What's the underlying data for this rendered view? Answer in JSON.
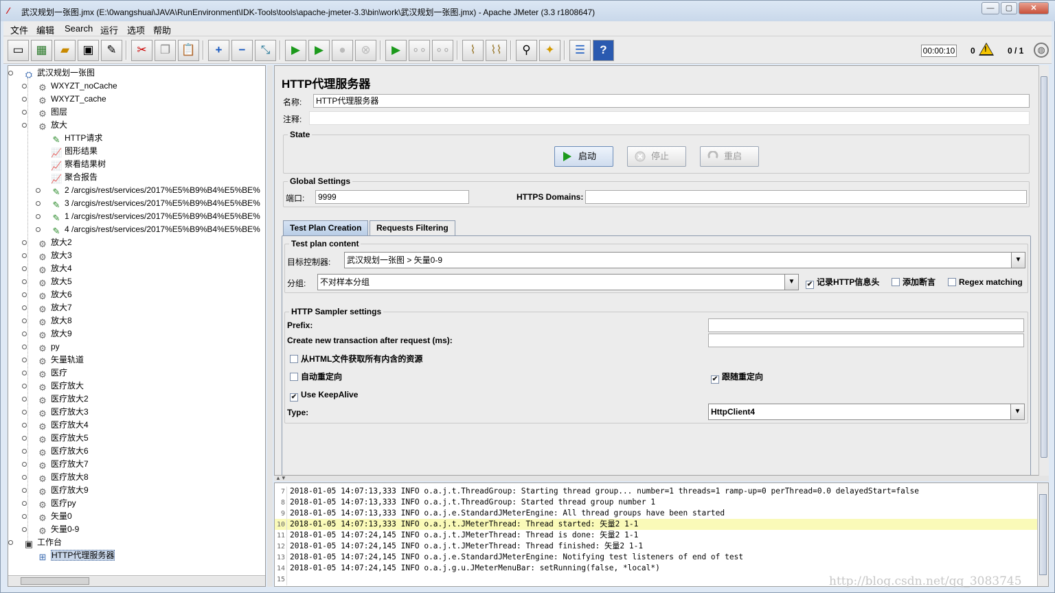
{
  "window": {
    "title": "武汉规划一张图.jmx (E:\\0wangshuai\\JAVA\\RunEnvironment\\IDK-Tools\\tools\\apache-jmeter-3.3\\bin\\work\\武汉规划一张图.jmx) - Apache JMeter (3.3 r1808647)",
    "min": "—",
    "max": "▢",
    "close": "✕"
  },
  "menu": [
    "文件",
    "编辑",
    "Search",
    "运行",
    "选项",
    "帮助"
  ],
  "toolbar": {
    "timer": "00:00:10",
    "errors": "0",
    "threads": "0 / 1",
    "icons": [
      "new-icon",
      "templates-icon",
      "open-icon",
      "save-icon",
      "save-as-icon",
      "cut-icon",
      "copy-icon",
      "paste-icon",
      "expand-icon",
      "collapse-icon",
      "toggle-icon",
      "start-icon",
      "start-no-pause-icon",
      "stop-icon",
      "shutdown-icon",
      "remote-start-icon",
      "remote-stop-icon",
      "remote-exit-icon",
      "clear-icon",
      "clear-all-icon",
      "search-icon",
      "reset-search-icon",
      "function-helper-icon",
      "help-icon"
    ]
  },
  "tree": {
    "items": [
      {
        "label": "武汉规划一张图",
        "icon": "test-plan-icon"
      },
      {
        "label": "WXYZT_noCache",
        "icon": "gear-icon"
      },
      {
        "label": "WXYZT_cache",
        "icon": "gear-icon"
      },
      {
        "label": "图层",
        "icon": "gear-icon"
      },
      {
        "label": "放大",
        "icon": "gear-icon"
      },
      {
        "label": "HTTP请求",
        "icon": "pipette-icon"
      },
      {
        "label": "图形结果",
        "icon": "graph-icon"
      },
      {
        "label": "察看结果树",
        "icon": "graph-icon"
      },
      {
        "label": "聚合报告",
        "icon": "graph-icon"
      },
      {
        "label": "2 /arcgis/rest/services/2017%E5%B9%B4%E5%BE%",
        "icon": "pipette-icon"
      },
      {
        "label": "3 /arcgis/rest/services/2017%E5%B9%B4%E5%BE%",
        "icon": "pipette-icon"
      },
      {
        "label": "1 /arcgis/rest/services/2017%E5%B9%B4%E5%BE%",
        "icon": "pipette-icon"
      },
      {
        "label": "4 /arcgis/rest/services/2017%E5%B9%B4%E5%BE%",
        "icon": "pipette-icon"
      },
      {
        "label": "放大2",
        "icon": "gear-icon"
      },
      {
        "label": "放大3",
        "icon": "gear-icon"
      },
      {
        "label": "放大4",
        "icon": "gear-icon"
      },
      {
        "label": "放大5",
        "icon": "gear-icon"
      },
      {
        "label": "放大6",
        "icon": "gear-icon"
      },
      {
        "label": "放大7",
        "icon": "gear-icon"
      },
      {
        "label": "放大8",
        "icon": "gear-icon"
      },
      {
        "label": "放大9",
        "icon": "gear-icon"
      },
      {
        "label": "py",
        "icon": "gear-icon"
      },
      {
        "label": "矢量轨道",
        "icon": "gear-icon"
      },
      {
        "label": "医疗",
        "icon": "gear-icon"
      },
      {
        "label": "医疗放大",
        "icon": "gear-icon"
      },
      {
        "label": "医疗放大2",
        "icon": "gear-icon"
      },
      {
        "label": "医疗放大3",
        "icon": "gear-icon"
      },
      {
        "label": "医疗放大4",
        "icon": "gear-icon"
      },
      {
        "label": "医疗放大5",
        "icon": "gear-icon"
      },
      {
        "label": "医疗放大6",
        "icon": "gear-icon"
      },
      {
        "label": "医疗放大7",
        "icon": "gear-icon"
      },
      {
        "label": "医疗放大8",
        "icon": "gear-icon"
      },
      {
        "label": "医疗放大9",
        "icon": "gear-icon"
      },
      {
        "label": "医疗py",
        "icon": "gear-icon"
      },
      {
        "label": "矢量0",
        "icon": "gear-icon"
      },
      {
        "label": "矢量0-9",
        "icon": "gear-icon"
      },
      {
        "label": "工作台",
        "icon": "workbench-icon"
      },
      {
        "label": "HTTP代理服务器",
        "icon": "proxy-icon"
      }
    ]
  },
  "panel": {
    "title": "HTTP代理服务器",
    "name_label": "名称:",
    "name_value": "HTTP代理服务器",
    "comment_label": "注释:",
    "comment_value": "",
    "state_group": "State",
    "start": "启动",
    "stop": "停止",
    "restart": "重启",
    "global_group": "Global Settings",
    "port_label": "端口:",
    "port_value": "9999",
    "https_label": "HTTPS Domains:",
    "https_value": "",
    "tabs": [
      "Test Plan Creation",
      "Requests Filtering"
    ],
    "content_group": "Test plan content",
    "target_label": "目标控制器:",
    "target_value": "武汉规划一张图 > 矢量0-9",
    "group_label": "分组:",
    "group_value": "不对样本分组",
    "record_headers": "记录HTTP信息头",
    "add_assertions": "添加断言",
    "regex_matching": "Regex matching",
    "sampler_group": "HTTP Sampler settings",
    "prefix_label": "Prefix:",
    "prefix_value": "",
    "transaction_label": "Create new transaction after request (ms):",
    "transaction_value": "",
    "retrieve_resources": "从HTML文件获取所有内含的资源",
    "auto_redirect": "自动重定向",
    "follow_redirects": "跟随重定向",
    "keepalive": "Use KeepAlive",
    "type_label": "Type:",
    "type_value": "HttpClient4",
    "checks": {
      "record_headers": true,
      "add_assertions": false,
      "regex_matching": false,
      "retrieve_resources": false,
      "auto_redirect": false,
      "follow_redirects": true,
      "keepalive": true
    }
  },
  "log": [
    {
      "n": "7",
      "t": "2018-01-05 14:07:13,333 INFO o.a.j.t.ThreadGroup: Starting thread group... number=1 threads=1 ramp-up=0 perThread=0.0 delayedStart=false"
    },
    {
      "n": "8",
      "t": "2018-01-05 14:07:13,333 INFO o.a.j.t.ThreadGroup: Started thread group number 1"
    },
    {
      "n": "9",
      "t": "2018-01-05 14:07:13,333 INFO o.a.j.e.StandardJMeterEngine: All thread groups have been started"
    },
    {
      "n": "10",
      "t": "2018-01-05 14:07:13,333 INFO o.a.j.t.JMeterThread: Thread started: 矢量2 1-1"
    },
    {
      "n": "11",
      "t": "2018-01-05 14:07:24,145 INFO o.a.j.t.JMeterThread: Thread is done: 矢量2 1-1"
    },
    {
      "n": "12",
      "t": "2018-01-05 14:07:24,145 INFO o.a.j.t.JMeterThread: Thread finished: 矢量2 1-1"
    },
    {
      "n": "13",
      "t": "2018-01-05 14:07:24,145 INFO o.a.j.e.StandardJMeterEngine: Notifying test listeners of end of test"
    },
    {
      "n": "14",
      "t": "2018-01-05 14:07:24,145 INFO o.a.j.g.u.JMeterMenuBar: setRunning(false, *local*)"
    },
    {
      "n": "15",
      "t": ""
    }
  ],
  "watermark": "http://blog.csdn.net/qq_3083745"
}
